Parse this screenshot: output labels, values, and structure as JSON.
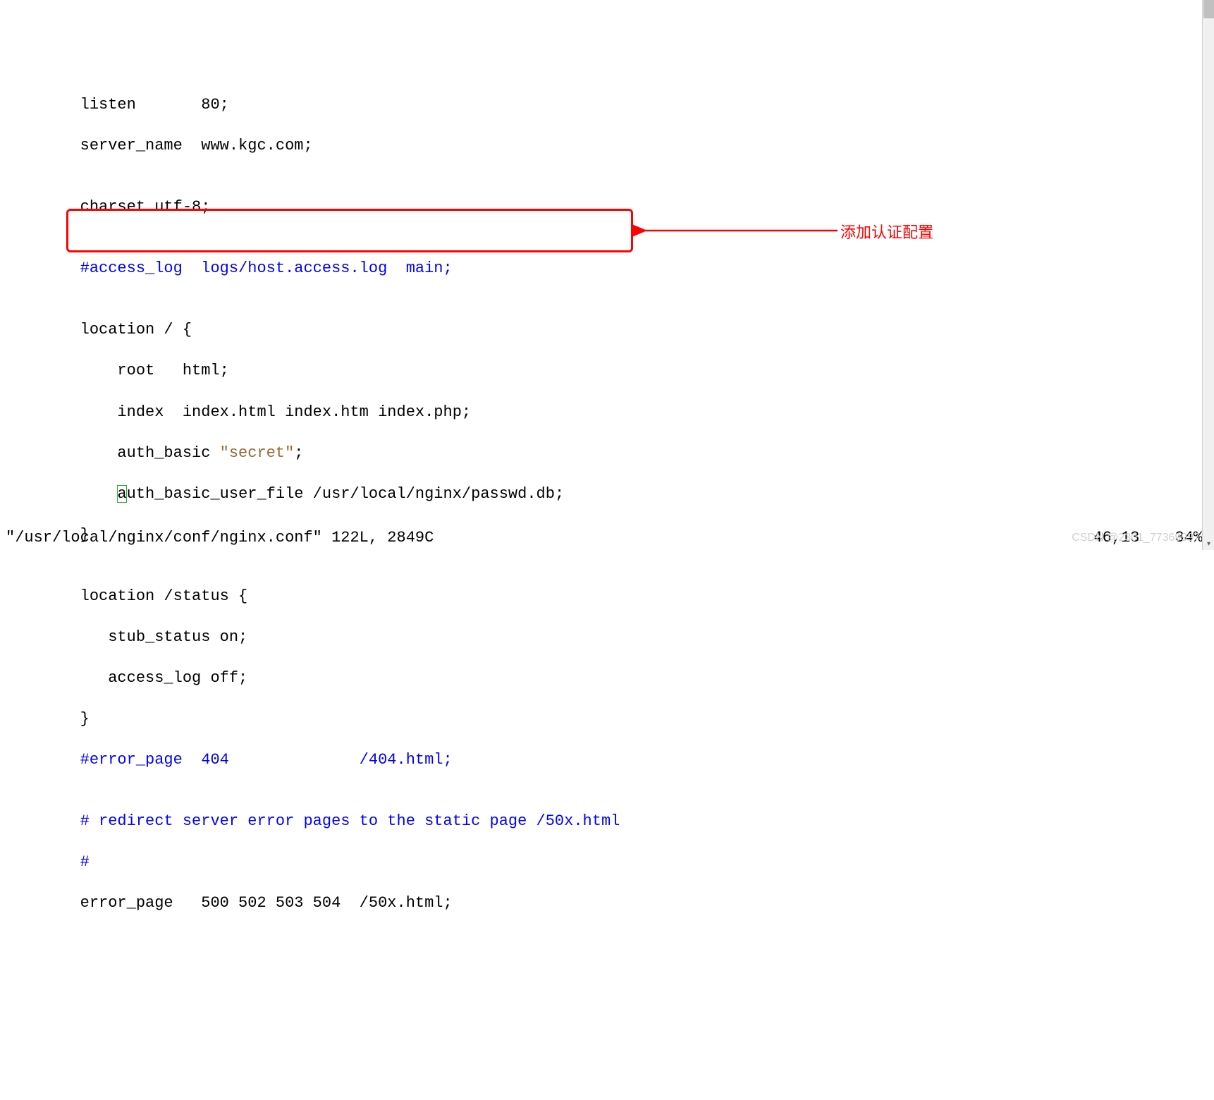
{
  "lines": {
    "l1": "        listen       80;",
    "l2": "        server_name  www.kgc.com;",
    "l3": "",
    "l4": "        charset utf-8;",
    "l5": "",
    "l6": "        #access_log  logs/host.access.log  main;",
    "l7": "",
    "l8": "        location / {",
    "l9": "            root   html;",
    "l10": "            index  index.html index.htm index.php;",
    "l11a": "            auth_basic ",
    "l11b": "\"secret\"",
    "l11c": ";",
    "l12a": "            ",
    "l12b": "a",
    "l12c": "uth_basic_user_file /usr/local/nginx/passwd.db;",
    "l13": "        }",
    "l14": "",
    "l15": "        location /status {",
    "l16": "           stub_status on;",
    "l17": "           access_log off;",
    "l18": "        }",
    "l19": "        #error_page  404              /404.html;",
    "l20": "",
    "l21": "        # redirect server error pages to the static page /50x.html",
    "l22": "        #",
    "l23": "        error_page   500 502 503 504  /50x.html;"
  },
  "status": {
    "file": "\"/usr/local/nginx/conf/nginx.conf\" 122L, 2849C",
    "position": "46,13",
    "percent": "34%"
  },
  "annotation": {
    "label": "添加认证配置"
  },
  "watermark": "CSDN @2301_77369997",
  "scrollbar": {
    "up": "▴",
    "down": "▾"
  }
}
